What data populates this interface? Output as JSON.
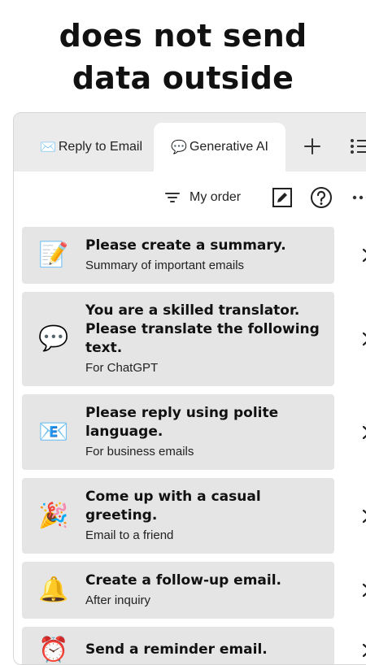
{
  "headline": [
    "does not send",
    "data outside"
  ],
  "tabs": [
    {
      "icon": "✉️",
      "icon_name": "envelope-icon",
      "label": "Reply to Email",
      "active": false
    },
    {
      "icon": "💬",
      "icon_name": "speech-bubble-icon",
      "label": "Generative AI",
      "active": true
    }
  ],
  "toolbar": {
    "sort_label": "My order"
  },
  "cards": [
    {
      "icon": "📝",
      "icon_name": "memo-icon",
      "title": "Please create a summary.",
      "subtitle": "Summary of important emails"
    },
    {
      "icon": "💬",
      "icon_name": "speech-bubble-icon",
      "title": "You are a skilled translator. Please translate the following text.",
      "subtitle": "For ChatGPT"
    },
    {
      "icon": "📧",
      "icon_name": "email-icon",
      "title": "Please reply using polite language.",
      "subtitle": "For business emails"
    },
    {
      "icon": "🎉",
      "icon_name": "party-popper-icon",
      "title": "Come up with a casual greeting.",
      "subtitle": "Email to a friend"
    },
    {
      "icon": "🔔",
      "icon_name": "bell-icon",
      "title": "Create a follow-up email.",
      "subtitle": "After inquiry"
    },
    {
      "icon": "⏰",
      "icon_name": "alarm-clock-icon",
      "title": "Send a reminder email.",
      "subtitle": ""
    }
  ]
}
